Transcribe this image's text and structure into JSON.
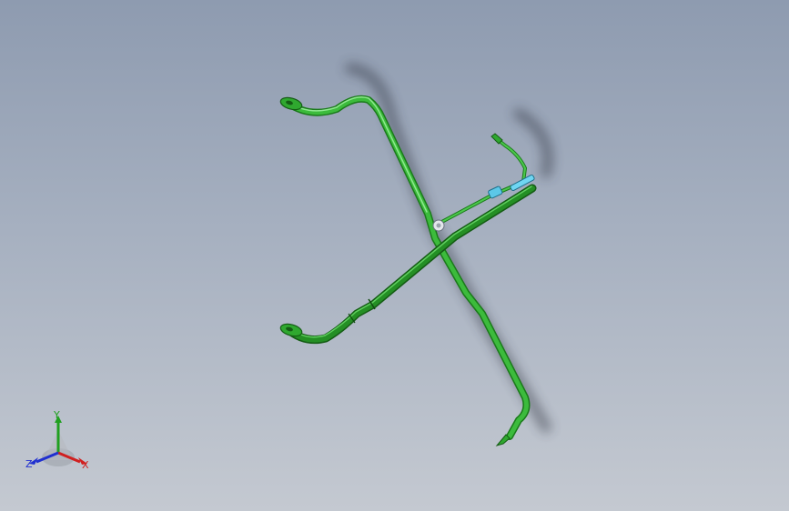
{
  "colors": {
    "pipe": "#2fa82f",
    "pipe_dark": "#1a7a1a",
    "pipe_highlight": "#7fe07f",
    "bracket": "#5cc8e8",
    "axis_x": "#d02020",
    "axis_y": "#20a020",
    "axis_z": "#2030d0"
  },
  "triad": {
    "x_label": "X",
    "y_label": "Y",
    "z_label": "Z"
  }
}
